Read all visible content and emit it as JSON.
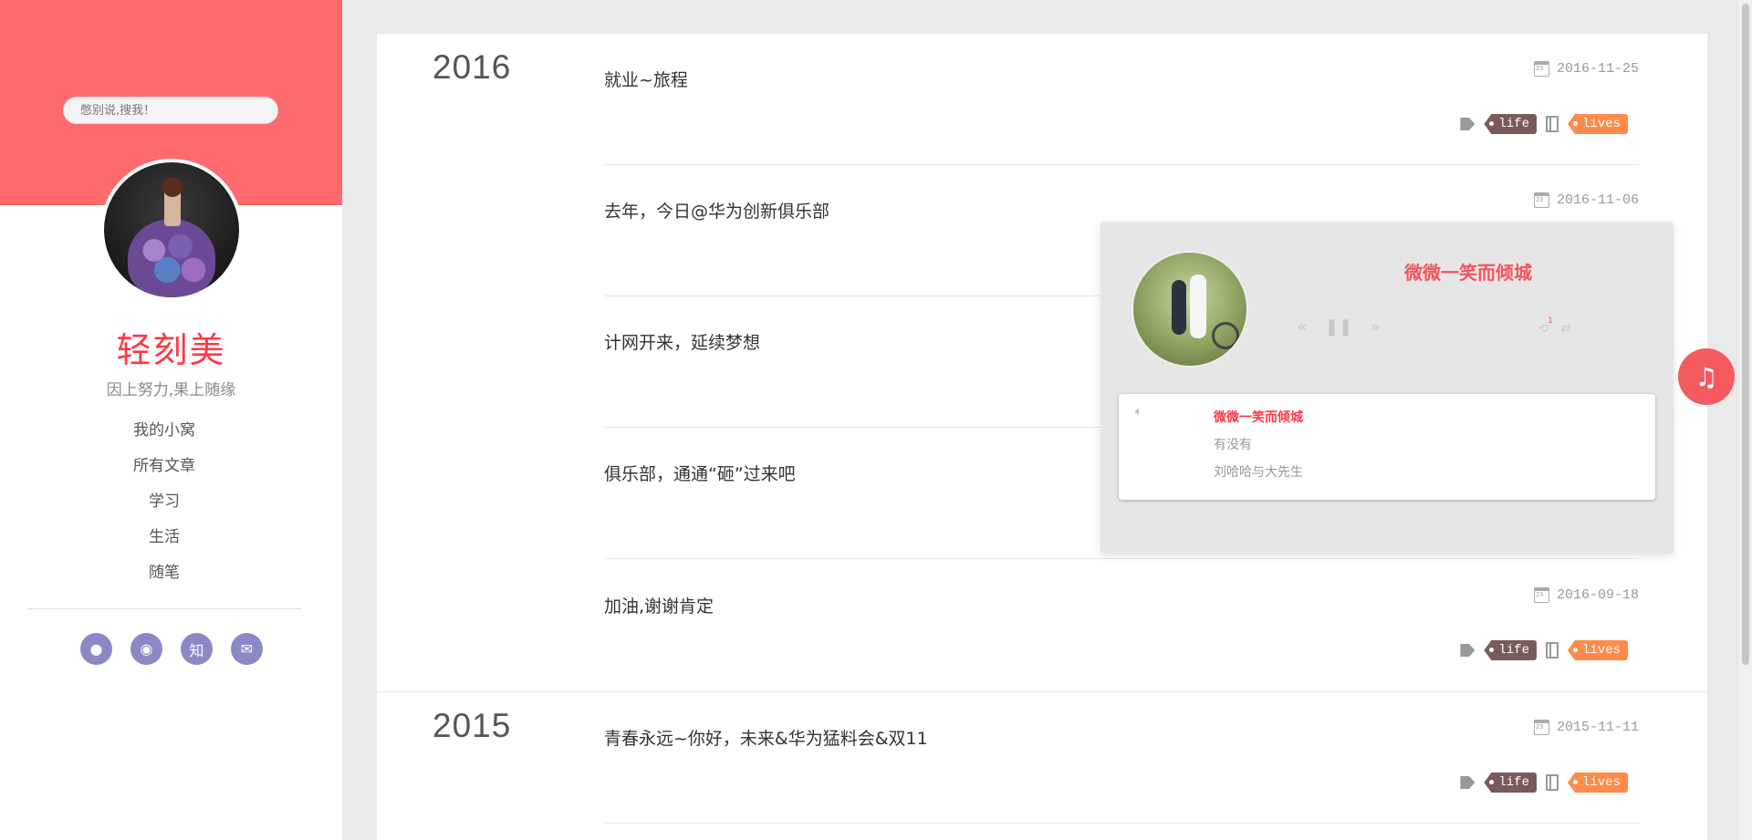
{
  "search": {
    "placeholder": "憋别说,搜我！"
  },
  "profile": {
    "name": "轻刻美",
    "motto": "因上努力,果上随缘"
  },
  "nav": [
    {
      "label": "我的小窝"
    },
    {
      "label": "所有文章"
    },
    {
      "label": "学习"
    },
    {
      "label": "生活"
    },
    {
      "label": "随笔"
    }
  ],
  "social": [
    {
      "icon": "github-icon",
      "glyph": "●"
    },
    {
      "icon": "weibo-icon",
      "glyph": "◉"
    },
    {
      "icon": "zhihu-icon",
      "glyph": "知"
    },
    {
      "icon": "mail-icon",
      "glyph": "✉"
    }
  ],
  "years": [
    "2016",
    "2015"
  ],
  "posts": [
    {
      "title": "就业~旅程",
      "date": "2016-11-25",
      "tag": "life",
      "category": "lives",
      "show_tags": true
    },
    {
      "title": "去年，今日@华为创新俱乐部",
      "date": "2016-11-06",
      "show_tags": false
    },
    {
      "title": "计网开来，延续梦想",
      "date": "",
      "show_tags": false
    },
    {
      "title": "俱乐部，通通“砸”过来吧",
      "date": "",
      "show_tags": false
    },
    {
      "title": "加油,谢谢肯定",
      "date": "2016-09-18",
      "tag": "life",
      "category": "lives",
      "show_tags": true
    },
    {
      "title": "青春永远~你好，未来&华为猛料会&双11",
      "date": "2015-11-11",
      "tag": "life",
      "category": "lives",
      "show_tags": true
    }
  ],
  "player": {
    "title": "微微一笑而倾城",
    "playlist": {
      "song": "微微一笑而倾城",
      "line2": "有没有",
      "artist": "刘哈哈与大先生"
    },
    "loop_badge": "1"
  },
  "colors": {
    "accent": "#fe6a6d",
    "title_red": "#ff3742",
    "tag_life": "#7a5a5a",
    "tag_lives": "#ff8a49",
    "social": "#8c88c5"
  }
}
